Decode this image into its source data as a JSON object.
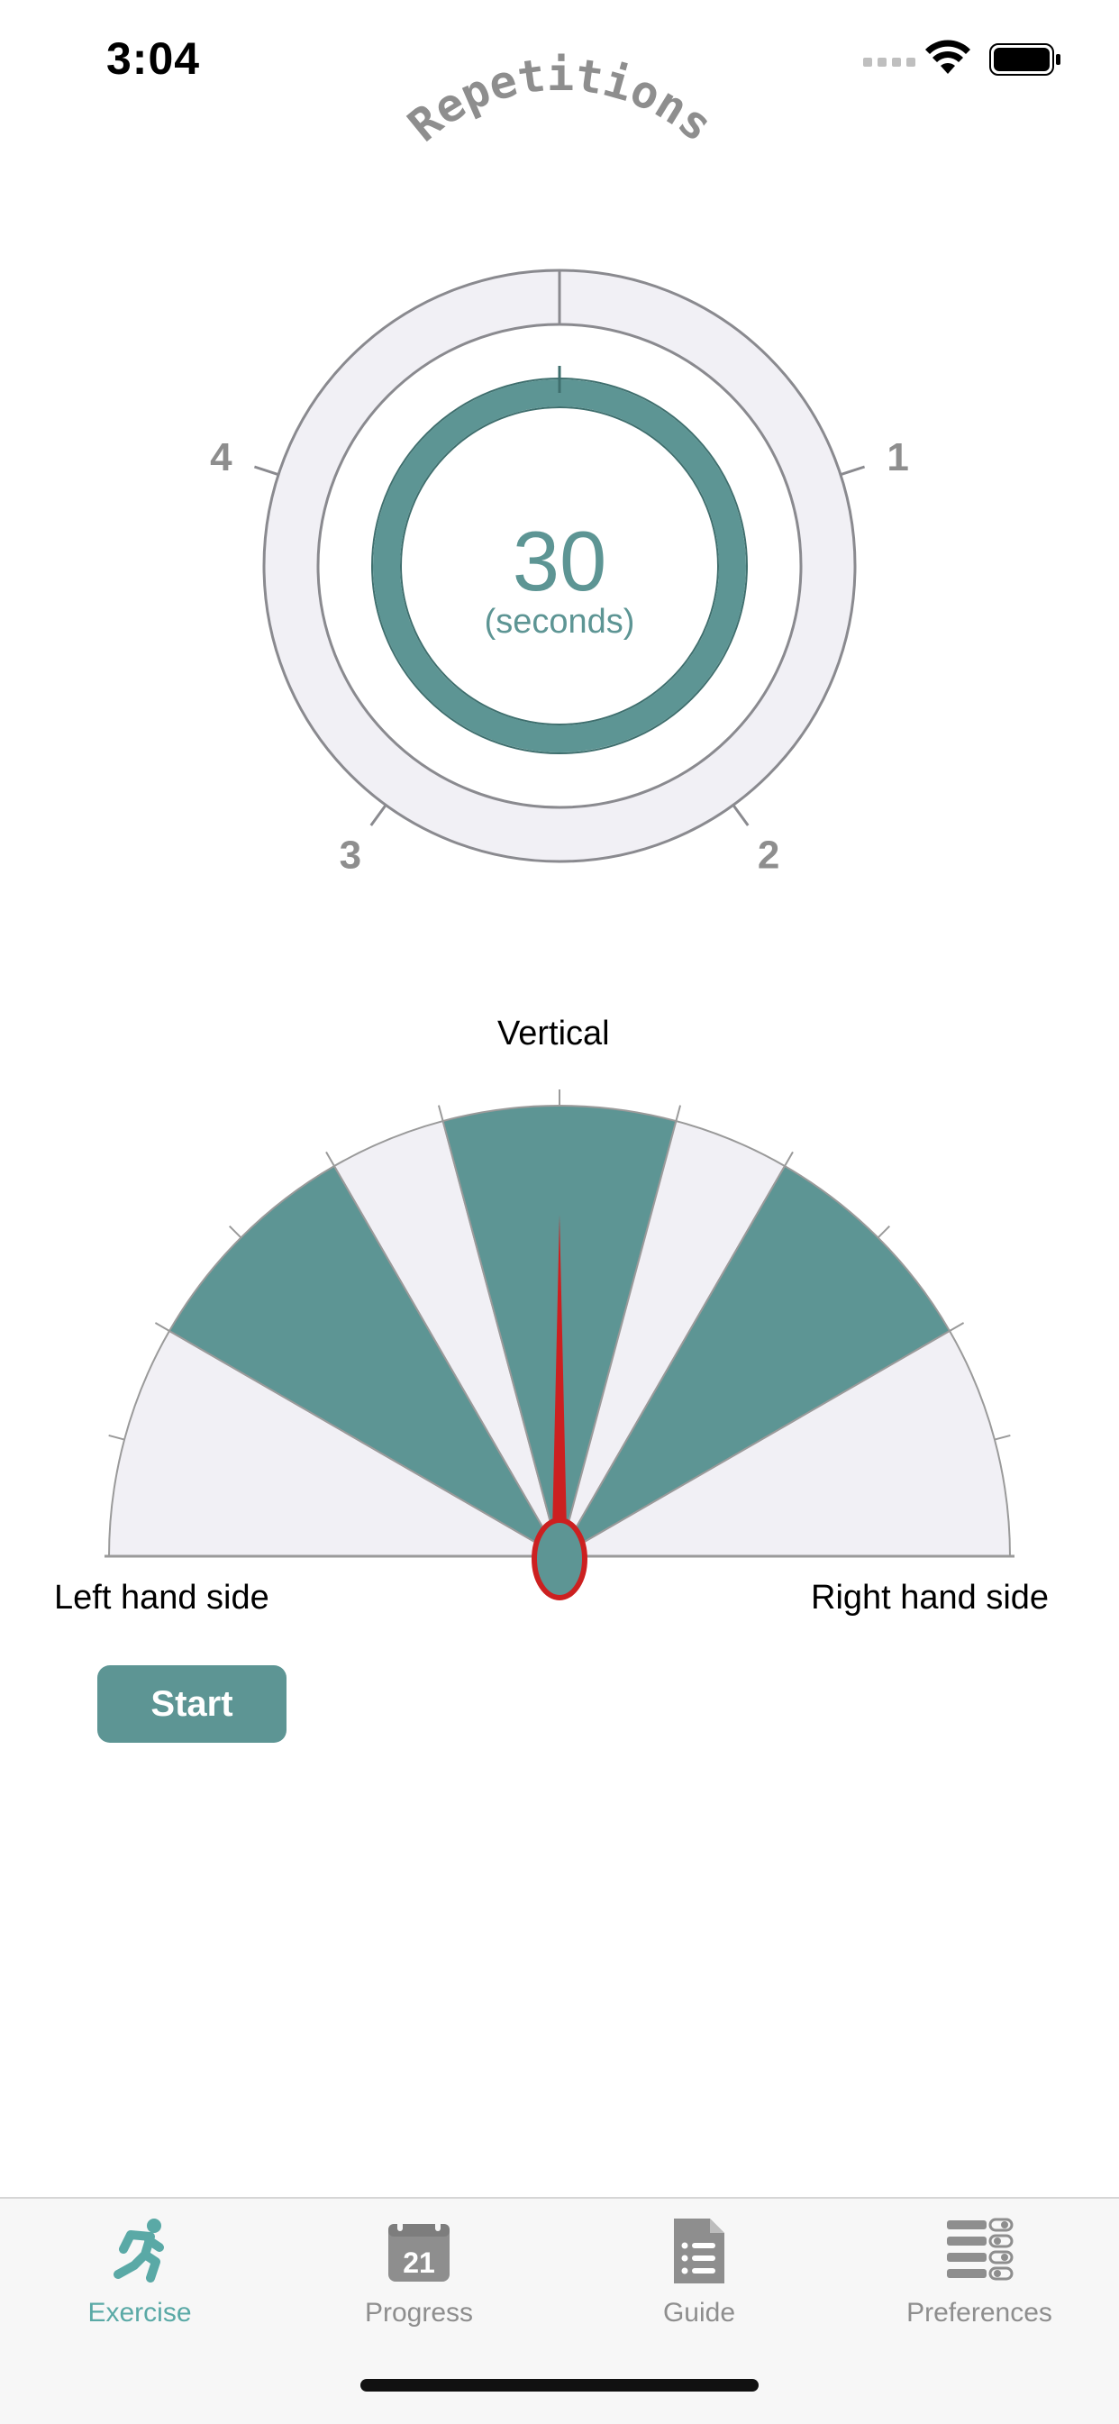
{
  "status_bar": {
    "time": "3:04"
  },
  "repetitions_gauge": {
    "title": "Repetitions",
    "value": "30",
    "unit": "(seconds)",
    "markers": [
      "1",
      "2",
      "3",
      "4"
    ],
    "progress": 1.0
  },
  "tilt_gauge": {
    "top_label": "Vertical",
    "left_label": "Left hand side",
    "right_label": "Right hand side",
    "needle_angle_deg": 0
  },
  "start_button": {
    "label": "Start"
  },
  "tab_bar": {
    "items": [
      {
        "label": "Exercise",
        "icon": "running-person-icon",
        "active": true
      },
      {
        "label": "Progress",
        "icon": "calendar-icon",
        "calendar_day": "21",
        "active": false
      },
      {
        "label": "Guide",
        "icon": "document-list-icon",
        "active": false
      },
      {
        "label": "Preferences",
        "icon": "settings-list-icon",
        "active": false
      }
    ]
  },
  "colors": {
    "accent": "#5d9594",
    "active_tab": "#5aa9a6",
    "needle": "#cc2020",
    "light_fill": "#f1f0f5",
    "ring_stroke": "#8a8a8f",
    "inactive": "#8e8e8e"
  }
}
